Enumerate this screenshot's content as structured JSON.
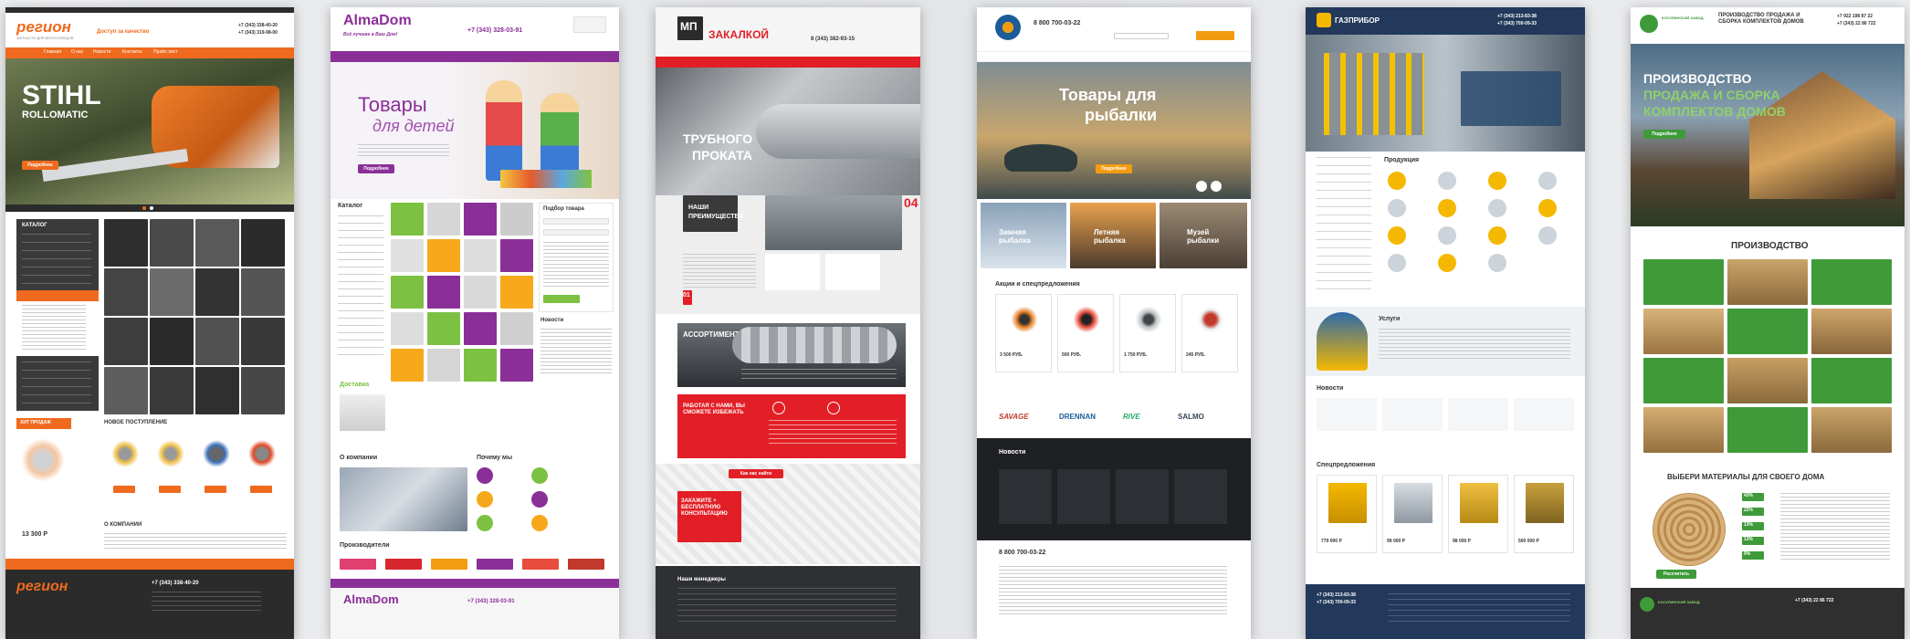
{
  "colors": {
    "region_orange": "#ef6a1e",
    "alma_purple": "#8b2f98",
    "zakalka_red": "#e21f26",
    "fishing_orange": "#f39c12",
    "gazpribor_navy": "#23395b",
    "house_green": "#3f9a3a"
  },
  "region": {
    "logo": "регион",
    "tagline": "ЗАПЧАСТИ ДЛЯ ВЕЛОСИПЕДОВ",
    "phone1": "+7 (343) 338-40-20",
    "phone2": "+7 (343) 319-98-00",
    "quality": "Доступ за качество",
    "nav": [
      "Главная",
      "О нас",
      "Новости",
      "Контакты",
      "Прайс-лист"
    ],
    "hero_title": "STIHL",
    "hero_sub": "ROLLOMATIC",
    "hero_btn": "Подробнее",
    "catalog_title": "КАТАЛОГ",
    "hit_title": "ХИТ ПРОДАЖ",
    "new_title": "НОВОЕ ПОСТУПЛЕНИЕ",
    "price": "13 300 Р",
    "about_title": "О КОМПАНИИ",
    "footer_phone": "+7 (343) 338-40-20"
  },
  "alma": {
    "logo": "AlmaDom",
    "slogan": "Всё лучшее в Ваш Дом!",
    "phone": "+7 (343) 328-03-91",
    "hero_title": "Товары",
    "hero_title2": "для детей",
    "hero_btn": "Подробнее",
    "catalog_title": "Каталог",
    "filter_title": "Подбор товара",
    "news_title": "Новости",
    "delivery_title": "Доставка",
    "about_title": "О компании",
    "why_title": "Почему мы",
    "makers_title": "Производители"
  },
  "zakalka": {
    "logo": "МП",
    "brand": "ЗАКАЛКОЙ",
    "phone": "8 (343) 382-93-15",
    "hero_title": "ТРУБНОГО",
    "hero_title2": "ПРОКАТА",
    "adv_title": "НАШИ",
    "adv_title2": "ПРЕИМУЩЕСТВА",
    "num1": "04",
    "num2": "01",
    "assort_title": "АССОРТИМЕНТ",
    "work_title": "РАБОТАЯ С НАМИ, ВЫ СМОЖЕТЕ ИЗБЕЖАТЬ",
    "order_title": "ЗАКАЖИТЕ + БЕСПЛАТНУЮ КОНСУЛЬТАЦИЮ",
    "map_btn": "Как нас найти",
    "managers": "Наши менеджеры"
  },
  "fishing": {
    "phone": "8 800 700-03-22",
    "hero_title": "Товары для",
    "hero_title2": "рыбалки",
    "hero_btn": "Подробнее",
    "tile1": "Зимняя рыбалка",
    "tile2": "Летняя рыбалка",
    "tile3": "Музей рыбалки",
    "promo_title": "Акции и спецпредложения",
    "prices": [
      "3 500 РУБ.",
      "500 РУБ.",
      "1 750 РУБ.",
      "245 РУБ."
    ],
    "brands": [
      "SAVAGE",
      "DRENNAN",
      "RIVE",
      "SALMO"
    ],
    "news_title": "Новости",
    "footer_phone": "8 800 700-03-22"
  },
  "gaz": {
    "logo": "ГАЗПРИБОР",
    "phone1": "+7 (343) 213-83-38",
    "phone2": "+7 (343) 700-09-33",
    "products_title": "Продукция",
    "services_title": "Услуги",
    "news_title": "Новости",
    "special_title": "Спецпредложения",
    "prices": [
      "779 000 Р",
      "99 000 Р",
      "98 000 Р",
      "500 000 Р"
    ]
  },
  "house": {
    "logo": "КОСУЛИНСКИЙ ЗАВОД",
    "header_title": "ПРОИЗВОДСТВО ПРОДАЖА И СБОРКА КОМПЛЕКТОВ ДОМОВ",
    "phone1": "+7 922 198 87 22",
    "phone2": "+7 (343) 22 86 722",
    "hero_title": "ПРОИЗВОДСТВО",
    "hero_title2": "ПРОДАЖА И СБОРКА",
    "hero_title3": "КОМПЛЕКТОВ ДОМОВ",
    "hero_btn": "Подробнее",
    "section_title": "ПРОИЗВОДСТВО",
    "choose_title": "ВЫБЕРИ МАТЕРИАЛЫ ДЛЯ СВОЕГО ДОМА",
    "percents": [
      "43%",
      "22%",
      "13%",
      "13%",
      "9%"
    ],
    "calc_btn": "Рассчитать"
  }
}
